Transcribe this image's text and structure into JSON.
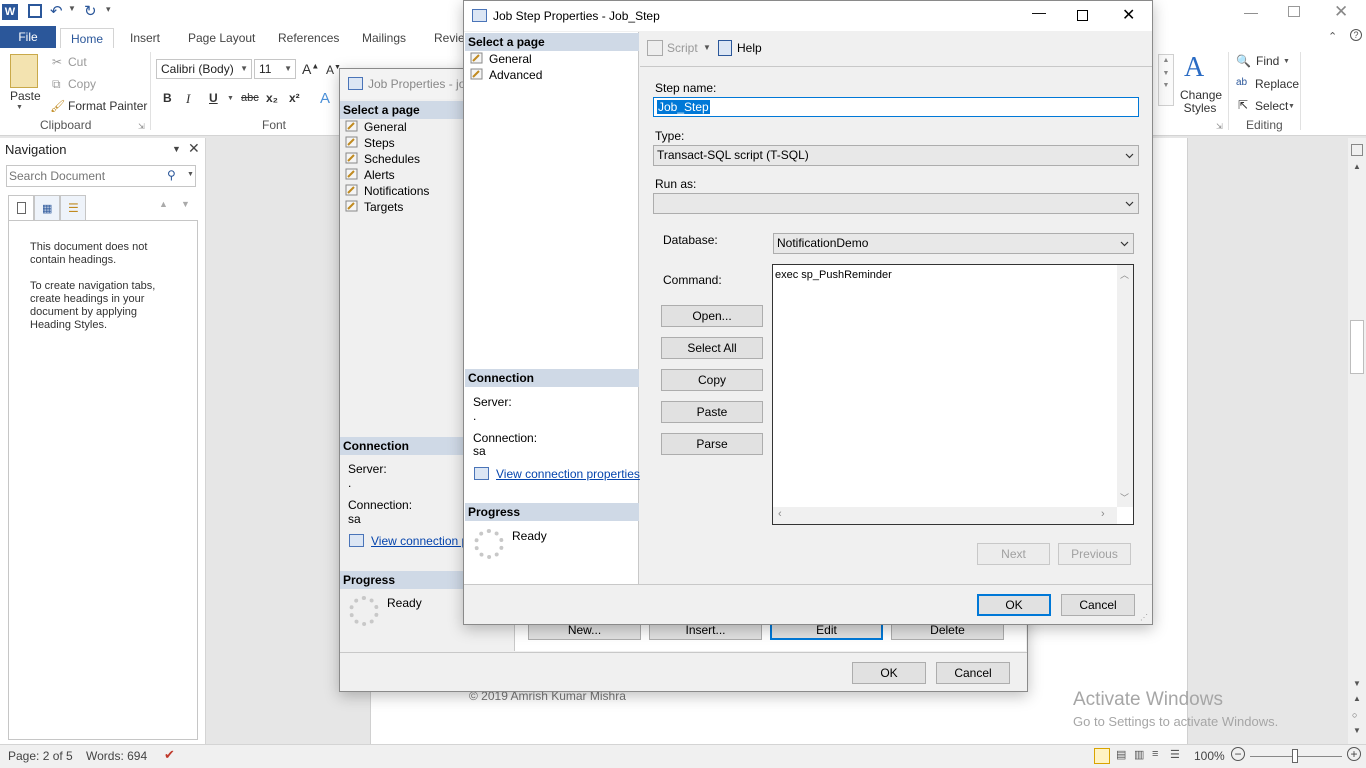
{
  "word": {
    "tabs": [
      "File",
      "Home",
      "Insert",
      "Page Layout",
      "References",
      "Mailings",
      "Revie"
    ],
    "clipboard": {
      "paste": "Paste",
      "cut": "Cut",
      "copy": "Copy",
      "format_painter": "Format Painter",
      "group": "Clipboard"
    },
    "font": {
      "name": "Calibri (Body)",
      "size": "11",
      "group": "Font",
      "bold": "B",
      "italic": "I",
      "underline": "U",
      "strike": "abc",
      "sub": "x₂",
      "sup": "x²"
    },
    "styles": {
      "change_styles": "Change Styles"
    },
    "editing": {
      "find": "Find",
      "replace": "Replace",
      "select": "Select",
      "group": "Editing"
    },
    "navigation": {
      "title": "Navigation",
      "search_placeholder": "Search Document",
      "message1": "This document does not contain headings.",
      "message2": "To create navigation tabs, create headings in your document by applying Heading Styles."
    },
    "doc": {
      "footer_text": "© 2019  Amrish Kumar Mishra",
      "buttons": [
        "New...",
        "Insert...",
        "Edit",
        "Delete"
      ]
    },
    "watermark": {
      "line1": "Activate Windows",
      "line2": "Go to Settings to activate Windows."
    },
    "status": {
      "page": "Page: 2 of 5",
      "words": "Words: 694",
      "zoom": "100%"
    }
  },
  "job_dialog": {
    "title": "Job Properties - jo",
    "select_page": "Select a page",
    "pages": [
      "General",
      "Steps",
      "Schedules",
      "Alerts",
      "Notifications",
      "Targets"
    ],
    "connection_hdr": "Connection",
    "server_label": "Server:",
    "server_value": ".",
    "connection_label": "Connection:",
    "connection_value": "sa",
    "view_link": "View connection pr",
    "progress_hdr": "Progress",
    "progress_status": "Ready",
    "ok": "OK",
    "cancel": "Cancel"
  },
  "step_dialog": {
    "title": "Job Step Properties - Job_Step",
    "select_page": "Select a page",
    "pages": [
      "General",
      "Advanced"
    ],
    "toolbar": {
      "script": "Script",
      "help": "Help"
    },
    "step_name_label": "Step name:",
    "step_name_value": "Job_Step",
    "type_label": "Type:",
    "type_value": "Transact-SQL script (T-SQL)",
    "run_as_label": "Run as:",
    "run_as_value": "",
    "database_label": "Database:",
    "database_value": "NotificationDemo",
    "command_label": "Command:",
    "command_value": "exec sp_PushReminder",
    "buttons": {
      "open": "Open...",
      "select_all": "Select All",
      "copy": "Copy",
      "paste": "Paste",
      "parse": "Parse"
    },
    "next": "Next",
    "previous": "Previous",
    "connection_hdr": "Connection",
    "server_label": "Server:",
    "server_value": ".",
    "connection_label": "Connection:",
    "connection_value": "sa",
    "view_link": "View connection properties",
    "progress_hdr": "Progress",
    "progress_status": "Ready",
    "ok": "OK",
    "cancel": "Cancel"
  },
  "colors": {
    "word_blue": "#2b579a",
    "section_header": "#cfd9e6",
    "link": "#0645ad",
    "focus": "#0078d7"
  }
}
